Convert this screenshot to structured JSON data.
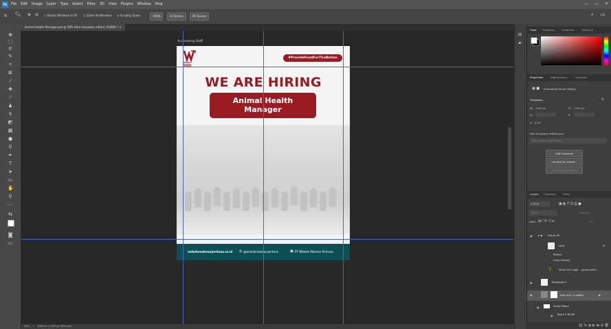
{
  "app": {
    "logo_text": "Ps"
  },
  "menu": [
    "File",
    "Edit",
    "Image",
    "Layer",
    "Type",
    "Select",
    "Filter",
    "3D",
    "View",
    "Plugins",
    "Window",
    "Help"
  ],
  "window_controls": [
    "—",
    "▭",
    "✕"
  ],
  "options": {
    "resize_windows": "Resize Windows to Fit",
    "zoom_all": "Zoom All Windows",
    "scrubby_zoom": "Scrubby Zoom",
    "zoom_level": "100%",
    "fit_screen": "Fit Screen",
    "fill_screen": "Fill Screen"
  },
  "document_tab": "Animal Health Manager.psd @ 50% (foto karyawan edited, RGB/8) *",
  "artboard_label": "Accounting Staff",
  "poster": {
    "logo_lines": [
      "WIDODO",
      "MAKMUR",
      "PERKASA"
    ],
    "hashtag": "#ProvideFoodForTheNation",
    "headline": "WE ARE HIRING",
    "position_line1": "Animal Health",
    "position_line2": "Manager",
    "footer_site": "widodomakmurperkasa.co.id",
    "footer_ig": "@widodomakmurperkasa",
    "footer_li": "PT Widodo Makmur Perkasa",
    "brand_red": "#9b1b22",
    "footer_teal": "#0e4f56"
  },
  "status": {
    "zoom": "50%",
    "doc": "1080 px x 1350 px (300 ppi)"
  },
  "panels": {
    "color_tabs": [
      "Color",
      "Swatches",
      "Gradients",
      "Patterns"
    ],
    "prop_tabs": [
      "Properties",
      "Adjustments",
      "Libraries"
    ],
    "embedded": "Embedded Smart Object",
    "transform": "Transform",
    "w_label": "W:",
    "w_value": "1080 px",
    "h_label": "H:",
    "h_value": "1350 px",
    "x_label": "X:",
    "y_label": "Y:",
    "angle": "0.00°",
    "filename": "foto karyawan edited.png",
    "layer_comp": "Don't Apply Layer Comp",
    "edit_contents": "Edit Contents",
    "convert_linked": "Convert to Linked...",
    "convert_layers": "Convert to Layers",
    "layer_tabs": [
      "Layers",
      "Channels",
      "Paths"
    ],
    "kind": "Q Kind",
    "blend": "Normal",
    "opacity_label": "Opacity:",
    "lock_label": "Lock:",
    "fill_label": "Fill:",
    "layers": [
      {
        "name": "Group 26",
        "type": "group"
      },
      {
        "name": "rand",
        "type": "layer"
      },
      {
        "name": "Effects",
        "type": "sub"
      },
      {
        "name": "Color Overlay",
        "type": "sub"
      },
      {
        "name": "Send CV & Appl... group.mail.li",
        "type": "text"
      },
      {
        "name": "Rectangle 3",
        "type": "layer"
      },
      {
        "name": "foto kary...n edited",
        "type": "smart"
      },
      {
        "name": "Smart Filters",
        "type": "sub"
      },
      {
        "name": "Black & White",
        "type": "sub"
      }
    ]
  }
}
